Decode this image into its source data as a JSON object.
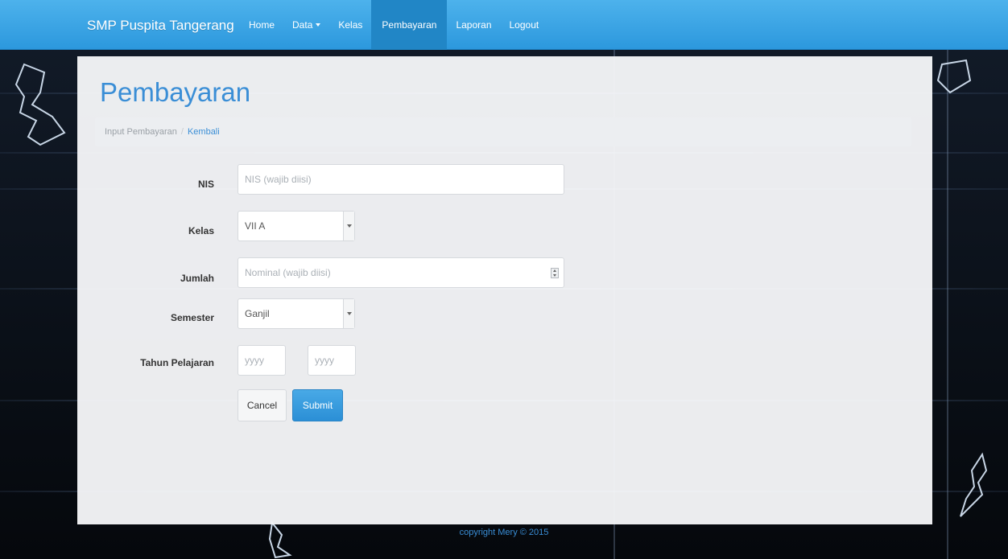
{
  "navbar": {
    "brand": "SMP Puspita Tangerang",
    "items": [
      {
        "label": "Home"
      },
      {
        "label": "Data"
      },
      {
        "label": "Kelas"
      },
      {
        "label": "Pembayaran"
      },
      {
        "label": "Laporan"
      },
      {
        "label": "Logout"
      }
    ],
    "active_item": "Pembayaran"
  },
  "page": {
    "title": "Pembayaran",
    "breadcrumb": {
      "current": "Input Pembayaran",
      "link": "Kembali"
    }
  },
  "form": {
    "nis": {
      "label": "NIS",
      "placeholder": "NIS (wajib diisi)"
    },
    "kelas": {
      "label": "Kelas",
      "value": "VII A"
    },
    "jumlah": {
      "label": "Jumlah",
      "placeholder": "Nominal (wajib diisi)"
    },
    "semester": {
      "label": "Semester",
      "value": "Ganjil"
    },
    "tahun": {
      "label": "Tahun Pelajaran",
      "start_placeholder": "yyyy",
      "end_placeholder": "yyyy"
    },
    "cancel_label": "Cancel",
    "submit_label": "Submit"
  },
  "footer": {
    "text": "copyright Mery © 2015"
  },
  "colors": {
    "navbar": "#2c98dd",
    "accent": "#3a8ed6",
    "submit": "#2b8fd6",
    "background": "#05070b"
  }
}
